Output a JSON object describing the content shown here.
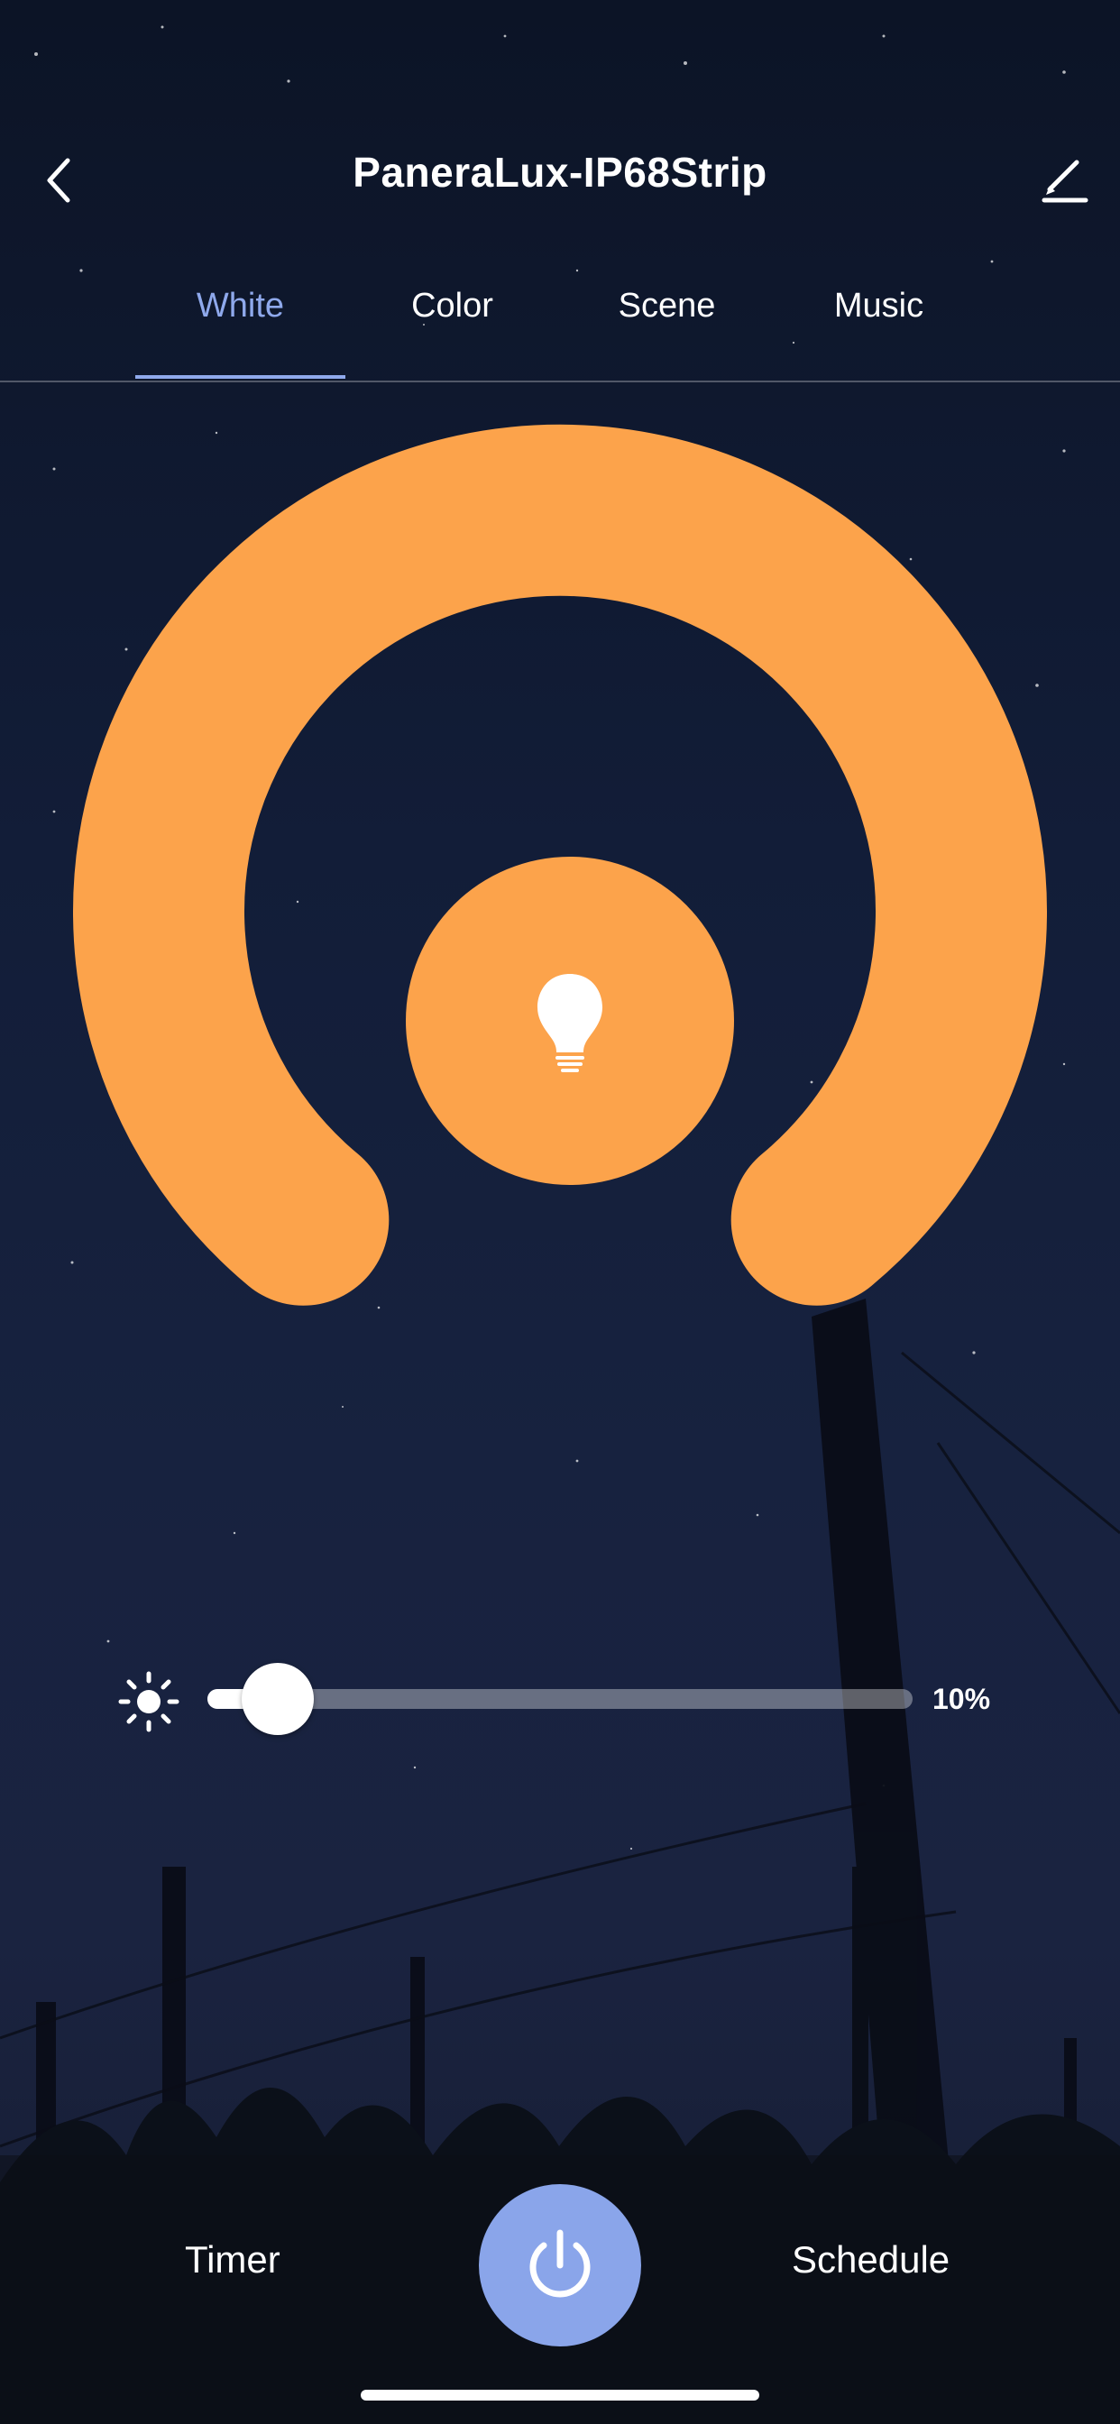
{
  "header": {
    "title": "PaneraLux-IP68Strip",
    "back_icon": "chevron-left-icon",
    "edit_icon": "pencil-icon"
  },
  "tabs": [
    {
      "label": "White",
      "active": true
    },
    {
      "label": "Color",
      "active": false
    },
    {
      "label": "Scene",
      "active": false
    },
    {
      "label": "Music",
      "active": false
    }
  ],
  "dial": {
    "color": "#FCA34B",
    "center_icon": "light-bulb-icon"
  },
  "brightness": {
    "icon": "sun-icon",
    "value": 0.1,
    "label": "10%"
  },
  "bottom_bar": {
    "timer_label": "Timer",
    "schedule_label": "Schedule",
    "power_icon": "power-icon",
    "power_color": "#8AA5EA"
  },
  "colors": {
    "accent": "#8FA9EC",
    "tab_active": "#8FA9EC"
  }
}
